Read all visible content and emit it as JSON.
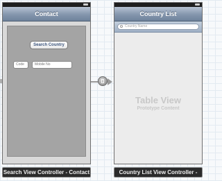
{
  "contact_scene": {
    "nav_title": "Contact",
    "search_button_label": "Search Country",
    "code_placeholder": "Code",
    "mobile_placeholder": "Mobile No",
    "caption": "Search View Controller - Contact"
  },
  "country_scene": {
    "nav_title": "Country List",
    "search_placeholder": "Country Name",
    "table_title": "Table View",
    "table_subtitle": "Prototype Content",
    "caption": "Country List View Controller -"
  },
  "icons": {
    "segue": "segue-icon",
    "search": "search-icon",
    "battery": "battery-icon"
  },
  "colors": {
    "navbar": "#8496ad",
    "content_view": "#a4a4a4",
    "table_background": "#ececec",
    "caption_background": "#2b2b2b"
  }
}
